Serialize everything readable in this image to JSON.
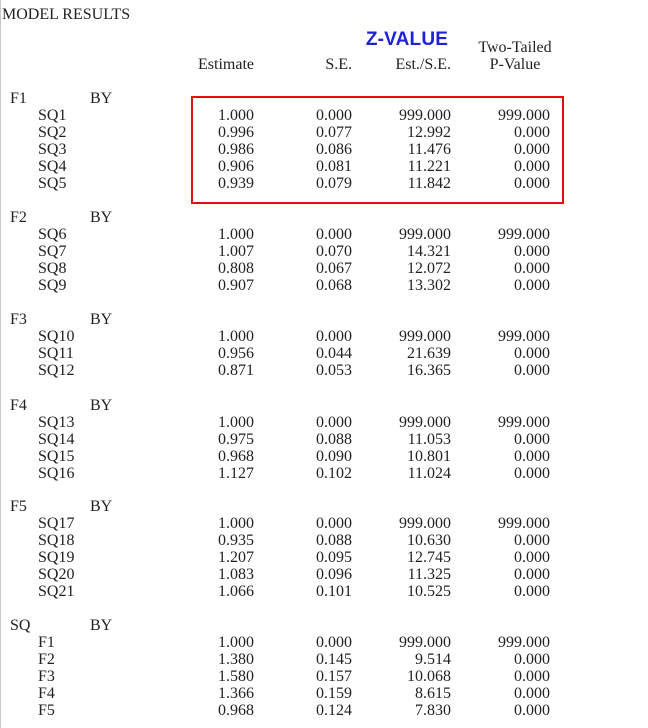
{
  "window_title": "MODEL RESULTS",
  "annotation": {
    "label": "Z-VALUE",
    "color": "#1f22d4",
    "highlight_color": "#e01010"
  },
  "columns": {
    "estimate": "Estimate",
    "se": "S.E.",
    "est_se": "Est./S.E.",
    "pvalue_line1": "Two-Tailed",
    "pvalue_line2": "P-Value"
  },
  "groups": [
    {
      "factor": "F1",
      "by": "BY",
      "rows": [
        {
          "item": "SQ1",
          "estimate": "1.000",
          "se": "0.000",
          "est_se": "999.000",
          "pvalue": "999.000"
        },
        {
          "item": "SQ2",
          "estimate": "0.996",
          "se": "0.077",
          "est_se": "12.992",
          "pvalue": "0.000"
        },
        {
          "item": "SQ3",
          "estimate": "0.986",
          "se": "0.086",
          "est_se": "11.476",
          "pvalue": "0.000"
        },
        {
          "item": "SQ4",
          "estimate": "0.906",
          "se": "0.081",
          "est_se": "11.221",
          "pvalue": "0.000"
        },
        {
          "item": "SQ5",
          "estimate": "0.939",
          "se": "0.079",
          "est_se": "11.842",
          "pvalue": "0.000"
        }
      ]
    },
    {
      "factor": "F2",
      "by": "BY",
      "rows": [
        {
          "item": "SQ6",
          "estimate": "1.000",
          "se": "0.000",
          "est_se": "999.000",
          "pvalue": "999.000"
        },
        {
          "item": "SQ7",
          "estimate": "1.007",
          "se": "0.070",
          "est_se": "14.321",
          "pvalue": "0.000"
        },
        {
          "item": "SQ8",
          "estimate": "0.808",
          "se": "0.067",
          "est_se": "12.072",
          "pvalue": "0.000"
        },
        {
          "item": "SQ9",
          "estimate": "0.907",
          "se": "0.068",
          "est_se": "13.302",
          "pvalue": "0.000"
        }
      ]
    },
    {
      "factor": "F3",
      "by": "BY",
      "rows": [
        {
          "item": "SQ10",
          "estimate": "1.000",
          "se": "0.000",
          "est_se": "999.000",
          "pvalue": "999.000"
        },
        {
          "item": "SQ11",
          "estimate": "0.956",
          "se": "0.044",
          "est_se": "21.639",
          "pvalue": "0.000"
        },
        {
          "item": "SQ12",
          "estimate": "0.871",
          "se": "0.053",
          "est_se": "16.365",
          "pvalue": "0.000"
        }
      ]
    },
    {
      "factor": "F4",
      "by": "BY",
      "rows": [
        {
          "item": "SQ13",
          "estimate": "1.000",
          "se": "0.000",
          "est_se": "999.000",
          "pvalue": "999.000"
        },
        {
          "item": "SQ14",
          "estimate": "0.975",
          "se": "0.088",
          "est_se": "11.053",
          "pvalue": "0.000"
        },
        {
          "item": "SQ15",
          "estimate": "0.968",
          "se": "0.090",
          "est_se": "10.801",
          "pvalue": "0.000"
        },
        {
          "item": "SQ16",
          "estimate": "1.127",
          "se": "0.102",
          "est_se": "11.024",
          "pvalue": "0.000"
        }
      ]
    },
    {
      "factor": "F5",
      "by": "BY",
      "rows": [
        {
          "item": "SQ17",
          "estimate": "1.000",
          "se": "0.000",
          "est_se": "999.000",
          "pvalue": "999.000"
        },
        {
          "item": "SQ18",
          "estimate": "0.935",
          "se": "0.088",
          "est_se": "10.630",
          "pvalue": "0.000"
        },
        {
          "item": "SQ19",
          "estimate": "1.207",
          "se": "0.095",
          "est_se": "12.745",
          "pvalue": "0.000"
        },
        {
          "item": "SQ20",
          "estimate": "1.083",
          "se": "0.096",
          "est_se": "11.325",
          "pvalue": "0.000"
        },
        {
          "item": "SQ21",
          "estimate": "1.066",
          "se": "0.101",
          "est_se": "10.525",
          "pvalue": "0.000"
        }
      ]
    },
    {
      "factor": "SQ",
      "by": "BY",
      "rows": [
        {
          "item": "F1",
          "estimate": "1.000",
          "se": "0.000",
          "est_se": "999.000",
          "pvalue": "999.000"
        },
        {
          "item": "F2",
          "estimate": "1.380",
          "se": "0.145",
          "est_se": "9.514",
          "pvalue": "0.000"
        },
        {
          "item": "F3",
          "estimate": "1.580",
          "se": "0.157",
          "est_se": "10.068",
          "pvalue": "0.000"
        },
        {
          "item": "F4",
          "estimate": "1.366",
          "se": "0.159",
          "est_se": "8.615",
          "pvalue": "0.000"
        },
        {
          "item": "F5",
          "estimate": "0.968",
          "se": "0.124",
          "est_se": "7.830",
          "pvalue": "0.000"
        }
      ]
    }
  ]
}
